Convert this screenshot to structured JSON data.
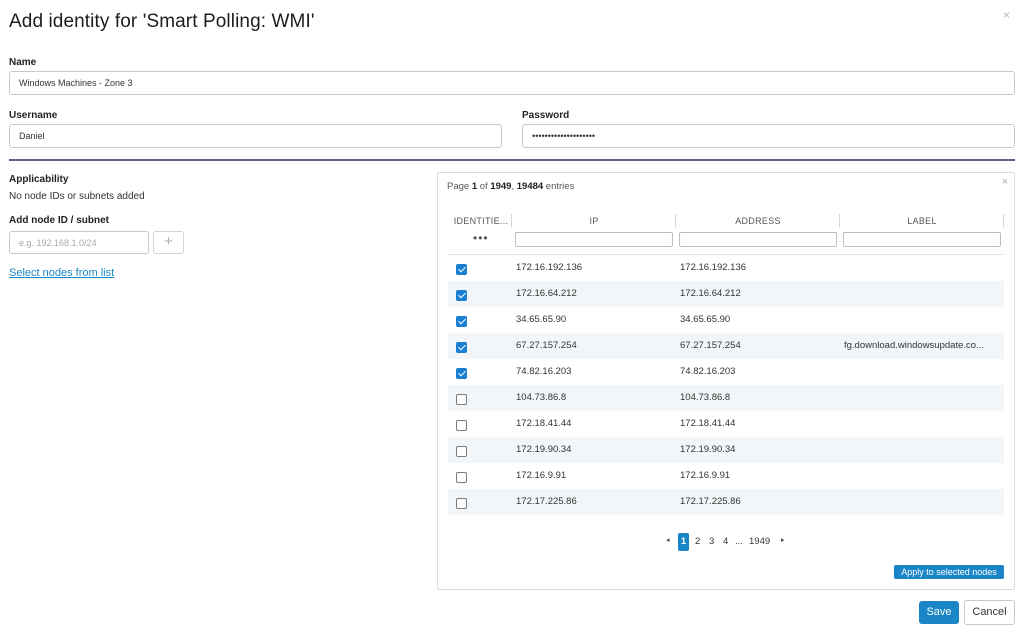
{
  "dialog": {
    "title": "Add identity for 'Smart Polling: WMI'",
    "close_icon": "×"
  },
  "form": {
    "name_label": "Name",
    "name_value": "Windows Machines - Zone 3",
    "username_label": "Username",
    "username_value": "Daniel",
    "password_label": "Password",
    "password_value": "••••••••••••••••••••"
  },
  "applicability": {
    "heading": "Applicability",
    "empty_text": "No node IDs or subnets added",
    "add_label": "Add node ID / subnet",
    "add_placeholder": "e.g. 192.168.1.0/24",
    "add_button": "+",
    "select_link": "Select nodes from list"
  },
  "panel": {
    "info_prefix": "Page ",
    "page": "1",
    "info_of": " of ",
    "total_pages": "1949",
    "info_sep": ", ",
    "total_entries": "19484",
    "info_suffix": " entries",
    "close_icon": "×",
    "columns": [
      "IDENTITIE...",
      "IP",
      "ADDRESS",
      "LABEL"
    ],
    "more_icon": "•••",
    "rows": [
      {
        "checked": true,
        "ip": "172.16.192.136",
        "address": "172.16.192.136",
        "label": ""
      },
      {
        "checked": true,
        "ip": "172.16.64.212",
        "address": "172.16.64.212",
        "label": ""
      },
      {
        "checked": true,
        "ip": "34.65.65.90",
        "address": "34.65.65.90",
        "label": ""
      },
      {
        "checked": true,
        "ip": "67.27.157.254",
        "address": "67.27.157.254",
        "label": "fg.download.windowsupdate.co..."
      },
      {
        "checked": true,
        "ip": "74.82.16.203",
        "address": "74.82.16.203",
        "label": ""
      },
      {
        "checked": false,
        "ip": "104.73.86.8",
        "address": "104.73.86.8",
        "label": ""
      },
      {
        "checked": false,
        "ip": "172.18.41.44",
        "address": "172.18.41.44",
        "label": ""
      },
      {
        "checked": false,
        "ip": "172.19.90.34",
        "address": "172.19.90.34",
        "label": ""
      },
      {
        "checked": false,
        "ip": "172.16.9.91",
        "address": "172.16.9.91",
        "label": ""
      },
      {
        "checked": false,
        "ip": "172.17.225.86",
        "address": "172.17.225.86",
        "label": ""
      }
    ],
    "pagination": {
      "prev": "◂",
      "current": "1",
      "pages": [
        "2",
        "3",
        "4"
      ],
      "ellipsis": "...",
      "last": "1949",
      "next": "▸"
    },
    "apply_button": "Apply to selected nodes"
  },
  "footer": {
    "save_button": "Save",
    "cancel_button": "Cancel"
  },
  "colors": {
    "accent": "#1a86c7",
    "checkbox": "#1a7fd3",
    "divider": "#5a6488",
    "row_alt": "#f3f6f8"
  }
}
